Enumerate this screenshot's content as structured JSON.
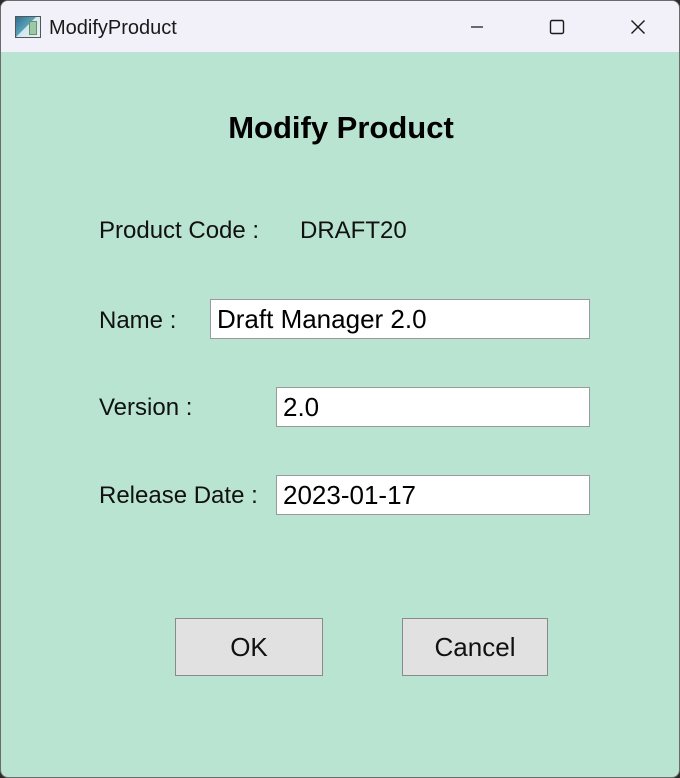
{
  "window": {
    "title": "ModifyProduct",
    "controls": {
      "minimize": "minimize-icon",
      "maximize": "maximize-icon",
      "close": "close-icon"
    }
  },
  "form": {
    "heading": "Modify Product",
    "product_code_label": "Product Code :",
    "product_code_value": "DRAFT20",
    "name_label": "Name :",
    "name_value": "Draft Manager 2.0",
    "version_label": "Version :",
    "version_value": "2.0",
    "release_date_label": "Release Date :",
    "release_date_value": "2023-01-17"
  },
  "buttons": {
    "ok_label": "OK",
    "cancel_label": "Cancel"
  },
  "colors": {
    "background": "#b9e4d2",
    "titlebar": "#f2f1f9",
    "button_face": "#e1e1e1"
  }
}
